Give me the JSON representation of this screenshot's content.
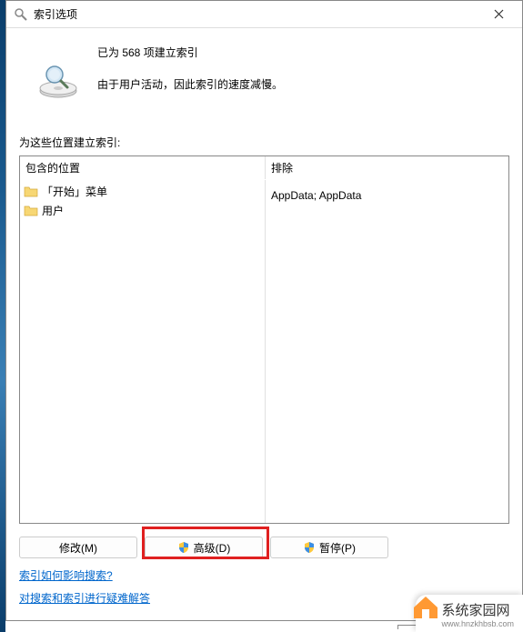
{
  "titlebar": {
    "title": "索引选项"
  },
  "status": {
    "line1": "已为 568 项建立索引",
    "line2": "由于用户活动，因此索引的速度减慢。"
  },
  "section_label": "为这些位置建立索引:",
  "table": {
    "header_include": "包含的位置",
    "header_exclude": "排除",
    "rows": [
      {
        "name": "「开始」菜单",
        "exclude": ""
      },
      {
        "name": "用户",
        "exclude": "AppData; AppData"
      }
    ]
  },
  "buttons": {
    "modify": "修改(M)",
    "advanced": "高级(D)",
    "pause": "暂停(P)"
  },
  "links": {
    "help1": "索引如何影响搜索?",
    "help2": "对搜索和索引进行疑难解答"
  },
  "watermark": {
    "text": "系统家园网",
    "url": "www.hnzkhbsb.com"
  }
}
